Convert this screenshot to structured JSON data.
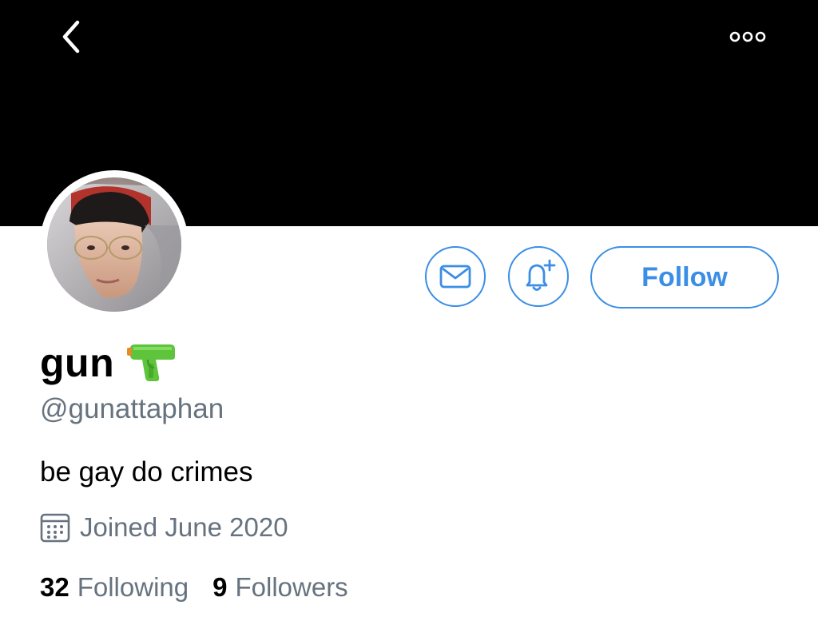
{
  "profile": {
    "display_name": "gun",
    "name_emoji": "water-pistol-emoji",
    "handle": "@gunattaphan",
    "bio": "be gay do crimes",
    "joined": "Joined June 2020"
  },
  "actions": {
    "follow_label": "Follow",
    "message_icon": "mail-icon",
    "notify_icon": "bell-plus-icon"
  },
  "stats": {
    "following_count": "32",
    "following_label": "Following",
    "followers_count": "9",
    "followers_label": "Followers"
  },
  "colors": {
    "banner": "#000000",
    "accent": "#3a8ee6",
    "secondary_text": "#66737f",
    "primary_text": "#000000"
  }
}
